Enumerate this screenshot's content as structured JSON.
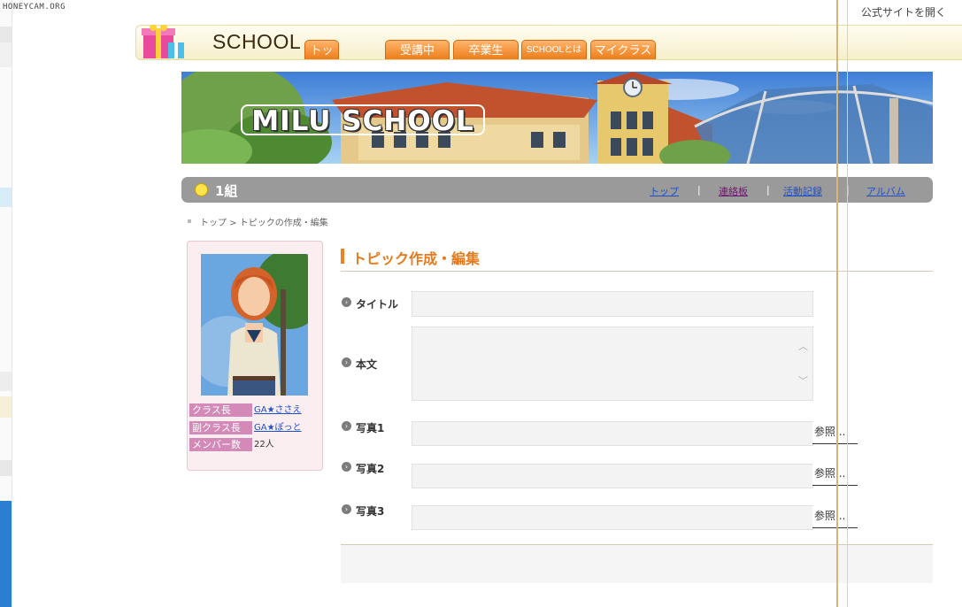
{
  "watermark": "HONEYCAM.ORG",
  "official_link": "公式サイトを開く",
  "header": {
    "logo_text": "SCHOOL",
    "tabs": [
      "トップ",
      "受講中",
      "卒業生",
      "SCHOOLとは",
      "マイクラス"
    ]
  },
  "banner": {
    "title": "MILU SCHOOL"
  },
  "classbar": {
    "class_name": "1組",
    "links": [
      "トップ",
      "連絡板",
      "活動記録",
      "アルバム"
    ],
    "separator": "|"
  },
  "breadcrumb": "トップ > トピックの作成・編集",
  "profile": {
    "rows": [
      {
        "label": "クラス長",
        "value": "GA★ささえ"
      },
      {
        "label": "副クラス長",
        "value": "GA★ぽっと"
      },
      {
        "label": "メンバー数",
        "value": "22人"
      }
    ]
  },
  "form": {
    "title": "トピック作成・編集",
    "fields": {
      "title_label": "タイトル",
      "body_label": "本文",
      "photo1_label": "写真1",
      "photo2_label": "写真2",
      "photo3_label": "写真3"
    },
    "browse_label": "参照..."
  },
  "colors": {
    "accent_orange": "#e57a1c",
    "class_bar": "#9a9a9a",
    "profile_label": "#d38ab8",
    "link": "#1f4fc7"
  },
  "icons": [
    "gift-icon",
    "smiley-icon",
    "chevron-right-icon",
    "scroll-up-icon",
    "scroll-down-icon"
  ]
}
